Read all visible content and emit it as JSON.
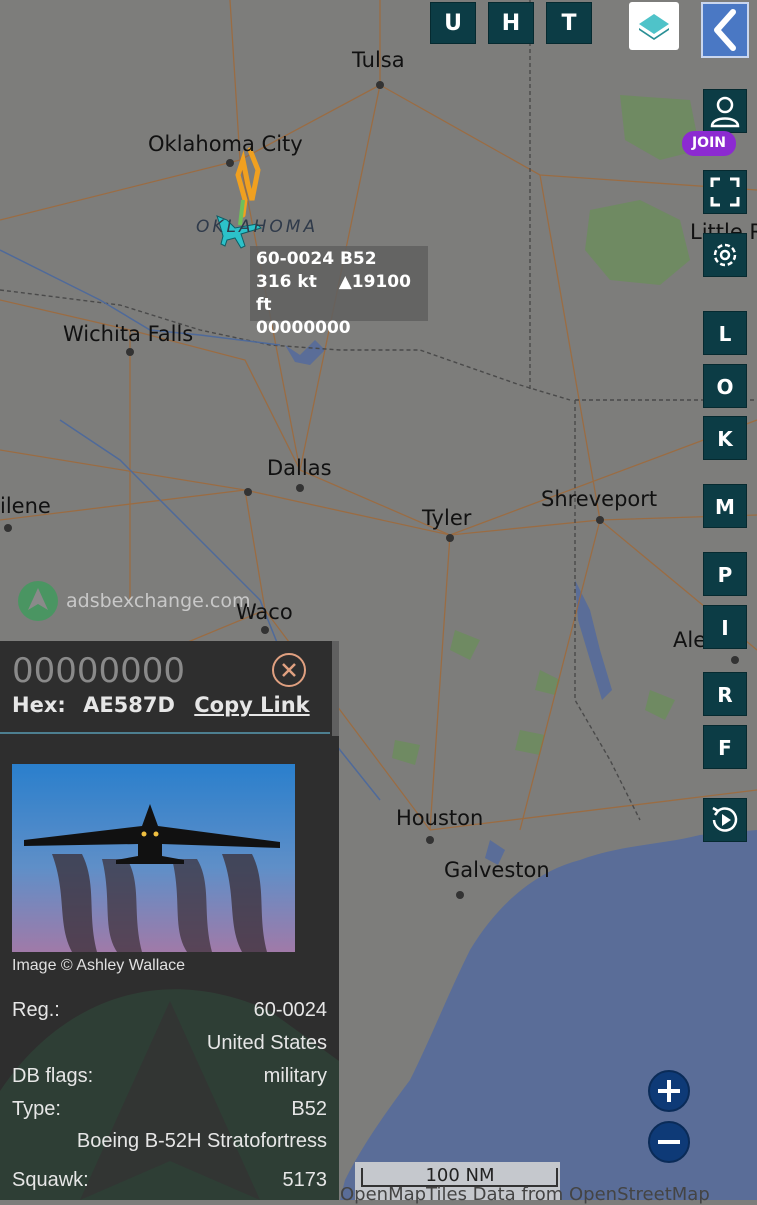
{
  "map": {
    "cities": [
      {
        "id": "tulsa",
        "name": "Tulsa"
      },
      {
        "id": "okc",
        "name": "Oklahoma City"
      },
      {
        "id": "wichita",
        "name": "Wichita Falls"
      },
      {
        "id": "dallas",
        "name": "Dallas"
      },
      {
        "id": "tyler",
        "name": "Tyler"
      },
      {
        "id": "shreveport",
        "name": "Shreveport"
      },
      {
        "id": "abilene",
        "name": "ilene"
      },
      {
        "id": "waco",
        "name": "Waco"
      },
      {
        "id": "houston",
        "name": "Houston"
      },
      {
        "id": "galveston",
        "name": "Galveston"
      },
      {
        "id": "littlerock",
        "name": "Little R"
      },
      {
        "id": "alexandria",
        "name": "Ale"
      }
    ],
    "state_label": "OKLAHOMA",
    "watermark": "adsbexchange.com",
    "scale_label": "100 NM",
    "attribution": "OpenMapTiles Data from OpenStreetMap"
  },
  "aircraft_label": {
    "line1": "60-0024 B52",
    "speed": "316 kt",
    "altitude": "▲19100 ft",
    "line3": "00000000"
  },
  "toolbar": {
    "top_buttons": [
      "U",
      "H",
      "T"
    ],
    "side_buttons": [
      "L",
      "O",
      "K",
      "M",
      "P",
      "I",
      "R",
      "F"
    ],
    "join_label": "JOIN"
  },
  "panel": {
    "callsign": "00000000",
    "hex_label": "Hex:",
    "hex_value": "AE587D",
    "copy_link": "Copy Link",
    "image_credit": "Image © Ashley Wallace",
    "rows": [
      {
        "key": "Reg.:",
        "value": "60-0024"
      },
      {
        "key": "",
        "value": "United States"
      },
      {
        "key": "DB flags:",
        "value": "military"
      },
      {
        "key": "Type:",
        "value": "B52"
      },
      {
        "key": "",
        "value": "Boeing B-52H Stratofortress"
      },
      {
        "key": "Squawk:",
        "value": "5173"
      }
    ]
  },
  "colors": {
    "land": "#7d7d7b",
    "water": "#5a6d98",
    "button_bg": "#0c3c45",
    "track": "#f0a020",
    "aircraft": "#2cc1c9",
    "join": "#8c2ad1"
  }
}
